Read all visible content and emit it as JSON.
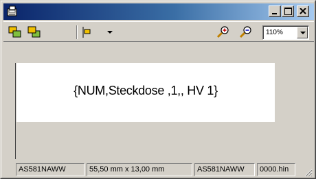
{
  "window": {
    "title": ""
  },
  "titlebar": {
    "minimize_label": "minimize",
    "maximize_label": "maximize",
    "close_label": "close"
  },
  "toolbar": {
    "buttons": [
      {
        "name": "bring-to-front-icon"
      },
      {
        "name": "send-to-back-icon"
      },
      {
        "name": "align-left-icon"
      },
      {
        "name": "dropdown-arrow-icon"
      },
      {
        "name": "zoom-in-icon"
      },
      {
        "name": "zoom-out-icon"
      }
    ],
    "zoom": {
      "value": "110%"
    }
  },
  "document": {
    "label_text": "{NUM,Steckdose ,1,, HV 1}"
  },
  "statusbar": {
    "printer": "AS581NAWW",
    "size": "55,50 mm x 13,00 mm",
    "printer_2": "AS581NAWW",
    "file": "0000.hin"
  },
  "colors": {
    "titlebar_start": "#0a246a",
    "titlebar_end": "#a6caf0",
    "face": "#d4d0c8"
  }
}
